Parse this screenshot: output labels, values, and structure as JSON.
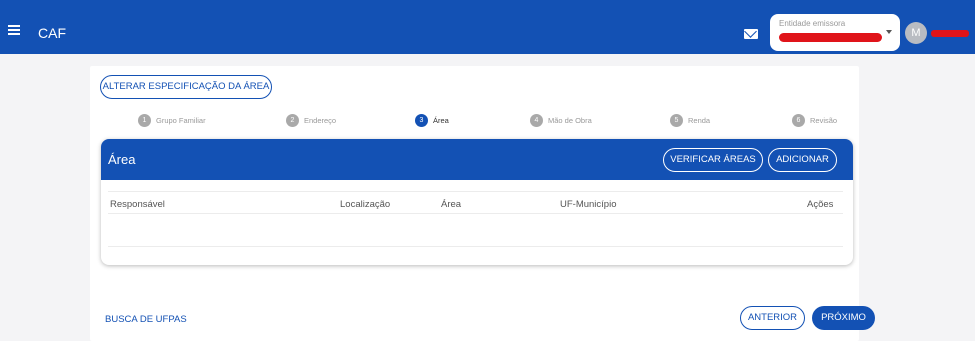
{
  "topbar": {
    "menu_icon": "hamburger-icon",
    "app_title": "CAF",
    "mail_icon": "envelope-icon",
    "entity_select": {
      "label": "Entidade emissora"
    },
    "avatar_initial": "M"
  },
  "actions": {
    "alter_area_label": "ALTERAR ESPECIFICAÇÃO DA ÁREA"
  },
  "steps": [
    {
      "number": "1",
      "label": "Grupo Familiar",
      "active": false
    },
    {
      "number": "2",
      "label": "Endereço",
      "active": false
    },
    {
      "number": "3",
      "label": "Área",
      "active": true
    },
    {
      "number": "4",
      "label": "Mão de Obra",
      "active": false
    },
    {
      "number": "5",
      "label": "Renda",
      "active": false
    },
    {
      "number": "6",
      "label": "Revisão",
      "active": false
    }
  ],
  "area_panel": {
    "title": "Área",
    "verify_label": "VERIFICAR ÁREAS",
    "add_label": "ADICIONAR",
    "columns": [
      "Responsável",
      "Localização",
      "Área",
      "UF-Município",
      "Ações"
    ]
  },
  "footer": {
    "search_link": "BUSCA DE UFPAS",
    "previous_label": "ANTERIOR",
    "next_label": "PRÓXIMO"
  },
  "colors": {
    "brand_blue": "#1351b4",
    "step_inactive": "#a9a9a9",
    "redaction": "#e0141a"
  }
}
